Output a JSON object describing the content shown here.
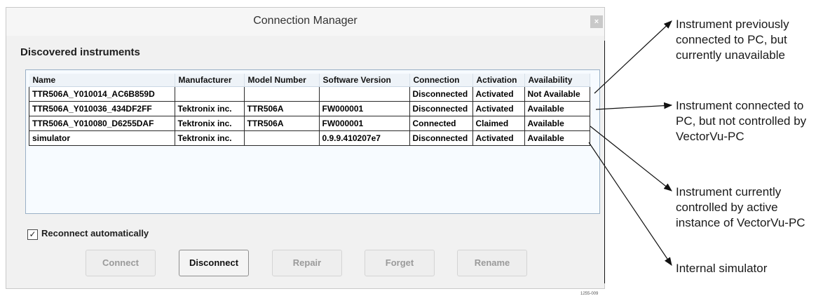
{
  "window": {
    "title": "Connection Manager",
    "close_label": "×"
  },
  "section_title": "Discovered instruments",
  "table": {
    "columns": [
      "Name",
      "Manufacturer",
      "Model Number",
      "Software Version",
      "Connection",
      "Activation",
      "Availability"
    ],
    "rows": [
      [
        "TTR506A_Y010014_AC6B859D",
        "",
        "",
        "",
        "Disconnected",
        "Activated",
        "Not Available"
      ],
      [
        "TTR506A_Y010036_434DF2FF",
        "Tektronix inc.",
        "TTR506A",
        "FW000001",
        "Disconnected",
        "Activated",
        "Available"
      ],
      [
        "TTR506A_Y010080_D6255DAF",
        "Tektronix inc.",
        "TTR506A",
        "FW000001",
        "Connected",
        "Claimed",
        "Available"
      ],
      [
        "simulator",
        "Tektronix inc.",
        "",
        "0.9.9.410207e7",
        "Disconnected",
        "Activated",
        "Available"
      ]
    ]
  },
  "reconnect": {
    "label": "Reconnect automatically",
    "checked": true,
    "check_glyph": "✓"
  },
  "buttons": {
    "connect": "Connect",
    "disconnect": "Disconnect",
    "repair": "Repair",
    "forget": "Forget",
    "rename": "Rename"
  },
  "annotations": {
    "a1": [
      "Instrument previously",
      "connected to PC, but",
      "currently unavailable"
    ],
    "a2": [
      "Instrument connected to",
      "PC, but not controlled by",
      "VectorVu-PC"
    ],
    "a3": [
      "Instrument currently",
      "controlled by active",
      "instance of VectorVu-PC"
    ],
    "a4": [
      "Internal simulator"
    ]
  },
  "figure_id": "1255-009"
}
